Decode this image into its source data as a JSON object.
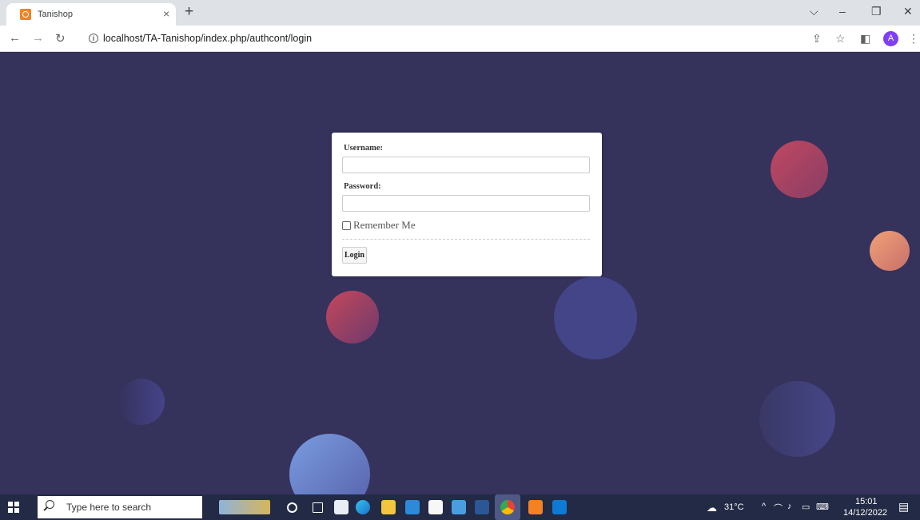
{
  "browser": {
    "tab_title": "Tanishop",
    "tab_close": "×",
    "new_tab": "+",
    "url": "localhost/TA-Tanishop/index.php/authcont/login",
    "profile_initial": "A",
    "win_minimize": "–",
    "win_restore": "❐",
    "win_close": "✕",
    "tab_search": "⌵"
  },
  "login": {
    "username_label": "Username:",
    "username_value": "",
    "password_label": "Password:",
    "password_value": "",
    "remember_label": "Remember Me",
    "login_button": "Login"
  },
  "taskbar": {
    "search_placeholder": "Type here to search",
    "weather": "31°C",
    "time": "15:01",
    "date": "14/12/2022"
  },
  "colors": {
    "page_background": "#35325c",
    "taskbar": "#222a45"
  }
}
